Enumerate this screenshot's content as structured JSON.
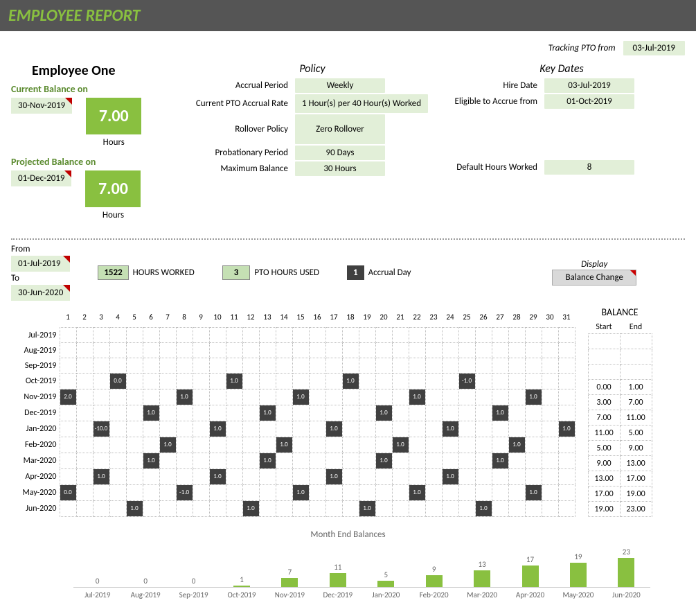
{
  "header": {
    "title": "EMPLOYEE REPORT"
  },
  "tracking": {
    "label": "Tracking PTO from",
    "date": "03-Jul-2019"
  },
  "employee": {
    "name": "Employee One"
  },
  "current_balance": {
    "label": "Current Balance on",
    "date": "30-Nov-2019",
    "value": "7.00",
    "unit": "Hours"
  },
  "projected_balance": {
    "label": "Projected Balance on",
    "date": "01-Dec-2019",
    "value": "7.00",
    "unit": "Hours"
  },
  "policy": {
    "title": "Policy",
    "accrual_period": {
      "k": "Accrual Period",
      "v": "Weekly"
    },
    "accrual_rate": {
      "k": "Current PTO Accrual Rate",
      "v": "1 Hour(s) per 40 Hour(s) Worked"
    },
    "rollover": {
      "k": "Rollover Policy",
      "v": "Zero Rollover"
    },
    "probation": {
      "k": "Probationary Period",
      "v": "90 Days"
    },
    "max_balance": {
      "k": "Maximum Balance",
      "v": "30 Hours"
    }
  },
  "key_dates": {
    "title": "Key Dates",
    "hire": {
      "k": "Hire Date",
      "v": "03-Jul-2019"
    },
    "eligible": {
      "k": "Eligible to Accrue from",
      "v": "01-Oct-2019"
    },
    "default_hours": {
      "k": "Default Hours Worked",
      "v": "8"
    }
  },
  "range": {
    "from_label": "From",
    "from": "01-Jul-2019",
    "to_label": "To",
    "to": "30-Jun-2020"
  },
  "stats": {
    "hours_worked_value": "1522",
    "hours_worked_label": "HOURS WORKED",
    "pto_used_value": "3",
    "pto_used_label": "PTO HOURS USED",
    "accrual_day_value": "1",
    "accrual_day_label": "Accrual Day"
  },
  "display": {
    "label": "Display",
    "button": "Balance Change"
  },
  "calendar": {
    "days": [
      "1",
      "2",
      "3",
      "4",
      "5",
      "6",
      "7",
      "8",
      "9",
      "10",
      "11",
      "12",
      "13",
      "14",
      "15",
      "16",
      "17",
      "18",
      "19",
      "20",
      "21",
      "22",
      "23",
      "24",
      "25",
      "26",
      "27",
      "28",
      "29",
      "30",
      "31"
    ],
    "rows": [
      {
        "month": "Jul-2019",
        "cells": {}
      },
      {
        "month": "Aug-2019",
        "cells": {}
      },
      {
        "month": "Sep-2019",
        "cells": {}
      },
      {
        "month": "Oct-2019",
        "cells": {
          "4": "0.0",
          "11": "1.0",
          "18": "1.0",
          "25": "-1.0"
        }
      },
      {
        "month": "Nov-2019",
        "cells": {
          "1": "2.0",
          "8": "1.0",
          "15": "1.0",
          "22": "1.0",
          "29": "1.0"
        }
      },
      {
        "month": "Dec-2019",
        "cells": {
          "6": "1.0",
          "13": "1.0",
          "20": "1.0",
          "27": "1.0"
        }
      },
      {
        "month": "Jan-2020",
        "cells": {
          "3": "-10.0",
          "10": "1.0",
          "17": "1.0",
          "24": "1.0",
          "31": "1.0"
        }
      },
      {
        "month": "Feb-2020",
        "cells": {
          "7": "1.0",
          "14": "1.0",
          "21": "1.0",
          "28": "1.0"
        }
      },
      {
        "month": "Mar-2020",
        "cells": {
          "6": "1.0",
          "13": "1.0",
          "20": "1.0",
          "27": "1.0"
        }
      },
      {
        "month": "Apr-2020",
        "cells": {
          "3": "1.0",
          "10": "1.0",
          "17": "1.0",
          "24": "1.0"
        }
      },
      {
        "month": "May-2020",
        "cells": {
          "1": "0.0",
          "8": "-1.0",
          "15": "1.0",
          "22": "1.0",
          "29": "1.0"
        }
      },
      {
        "month": "Jun-2020",
        "cells": {
          "5": "1.0",
          "12": "1.0",
          "19": "1.0",
          "26": "1.0"
        }
      }
    ]
  },
  "balance": {
    "header": "BALANCE",
    "start_label": "Start",
    "end_label": "End",
    "rows": [
      {
        "start": "",
        "end": ""
      },
      {
        "start": "",
        "end": ""
      },
      {
        "start": "",
        "end": ""
      },
      {
        "start": "0.00",
        "end": "1.00"
      },
      {
        "start": "3.00",
        "end": "7.00"
      },
      {
        "start": "7.00",
        "end": "11.00"
      },
      {
        "start": "11.00",
        "end": "5.00"
      },
      {
        "start": "5.00",
        "end": "9.00"
      },
      {
        "start": "9.00",
        "end": "13.00"
      },
      {
        "start": "13.00",
        "end": "17.00"
      },
      {
        "start": "17.00",
        "end": "19.00"
      },
      {
        "start": "19.00",
        "end": "23.00"
      }
    ]
  },
  "chart_data": {
    "type": "bar",
    "title": "Month End Balances",
    "categories": [
      "Jul-2019",
      "Aug-2019",
      "Sep-2019",
      "Oct-2019",
      "Nov-2019",
      "Dec-2019",
      "Jan-2020",
      "Feb-2020",
      "Mar-2020",
      "Apr-2020",
      "May-2020",
      "Jun-2020"
    ],
    "values": [
      0,
      0,
      0,
      1,
      7,
      11,
      5,
      9,
      13,
      17,
      19,
      23
    ],
    "ylim": [
      0,
      25
    ],
    "xlabel": "",
    "ylabel": ""
  }
}
